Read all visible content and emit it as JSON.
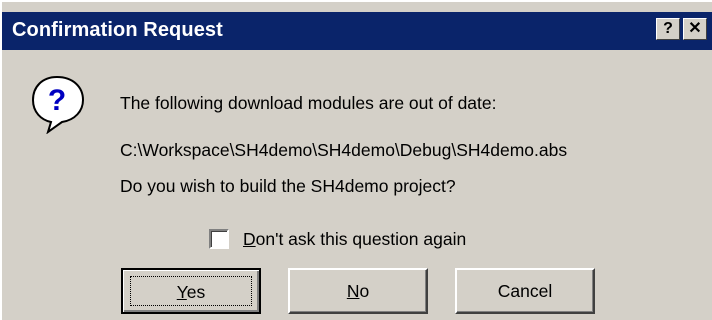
{
  "window": {
    "title": "Confirmation Request",
    "help_glyph": "?",
    "close_glyph": "✕"
  },
  "icon": {
    "name": "question-icon",
    "glyph": "?"
  },
  "message": {
    "line1": "The following download modules are out of date:",
    "line2": "C:\\Workspace\\SH4demo\\SH4demo\\Debug\\SH4demo.abs",
    "line3": "Do you wish to build the SH4demo project?"
  },
  "checkbox": {
    "label_mnemonic": "D",
    "label_rest": "on't ask this question again",
    "checked": false
  },
  "buttons": {
    "yes_mnemonic": "Y",
    "yes_rest": "es",
    "no_mnemonic": "N",
    "no_rest": "o",
    "cancel": "Cancel"
  },
  "colors": {
    "titlebar": "#0a246a",
    "face": "#d4d0c8"
  }
}
